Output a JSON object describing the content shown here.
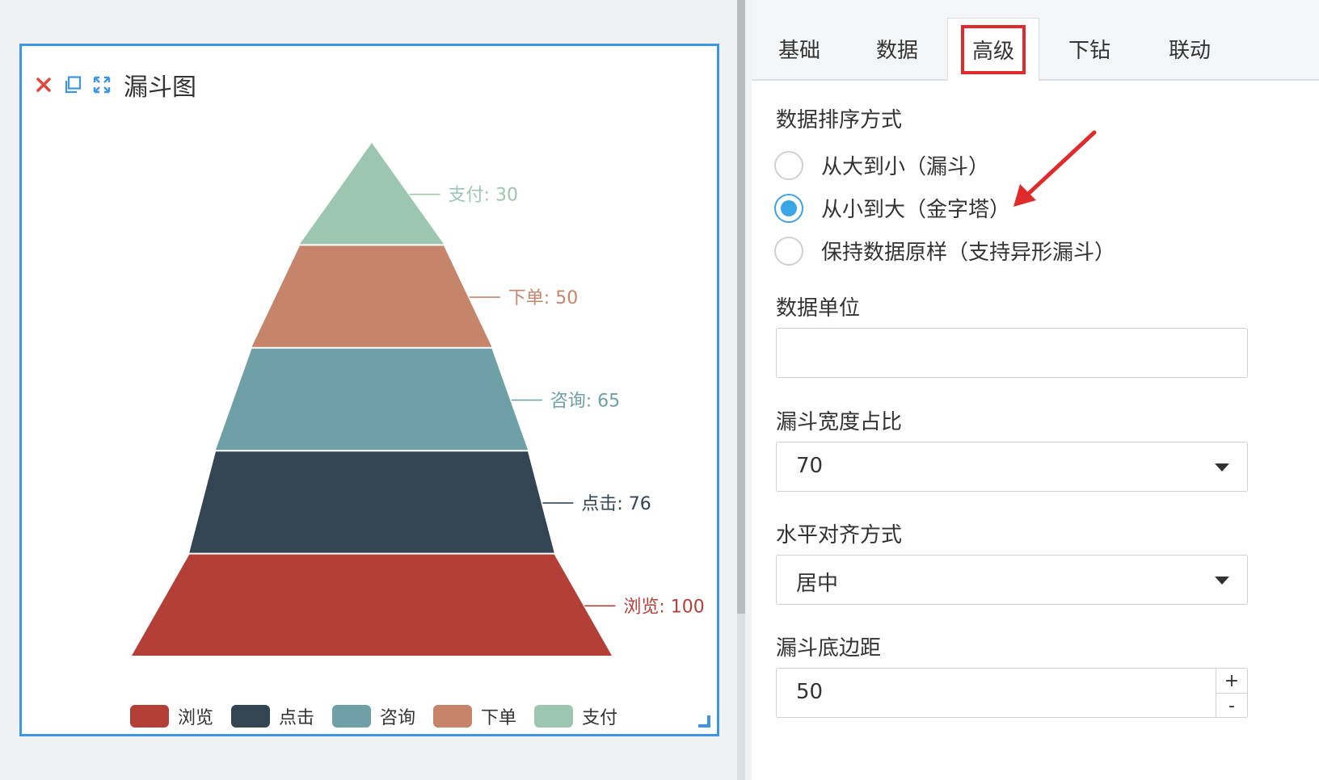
{
  "card": {
    "title": "漏斗图",
    "icons": [
      "close-icon",
      "copy-icon",
      "expand-icon"
    ]
  },
  "colors": {
    "accent": "#3c95e6",
    "highlight": "#e02b2b",
    "radio": "#3aa5e5"
  },
  "chart_data": {
    "type": "funnel",
    "sort": "ascending",
    "stages": [
      {
        "name": "浏览",
        "value": 100,
        "color": "#b43f37"
      },
      {
        "name": "点击",
        "value": 76,
        "color": "#334553"
      },
      {
        "name": "咨询",
        "value": 65,
        "color": "#6fa0a7"
      },
      {
        "name": "下单",
        "value": 50,
        "color": "#c6846a"
      },
      {
        "name": "支付",
        "value": 30,
        "color": "#9cc6b0"
      }
    ],
    "legend": [
      "浏览",
      "点击",
      "咨询",
      "下单",
      "支付"
    ],
    "legend_position": "bottom"
  },
  "tabs": [
    {
      "label": "基础"
    },
    {
      "label": "数据"
    },
    {
      "label": "高级"
    },
    {
      "label": "下钻"
    },
    {
      "label": "联动"
    }
  ],
  "active_tab": "高级",
  "sort_section": {
    "label": "数据排序方式",
    "options": [
      {
        "label": "从大到小（漏斗）"
      },
      {
        "label": "从小到大（金字塔）"
      },
      {
        "label": "保持数据原样（支持异形漏斗）"
      }
    ],
    "selected": "从小到大（金字塔）"
  },
  "unit": {
    "label": "数据单位",
    "value": ""
  },
  "width_ratio": {
    "label": "漏斗宽度占比",
    "value": "70"
  },
  "align": {
    "label": "水平对齐方式",
    "value": "居中"
  },
  "bottom_margin": {
    "label": "漏斗底边距",
    "value": "50",
    "plus": "+",
    "minus": "-"
  }
}
